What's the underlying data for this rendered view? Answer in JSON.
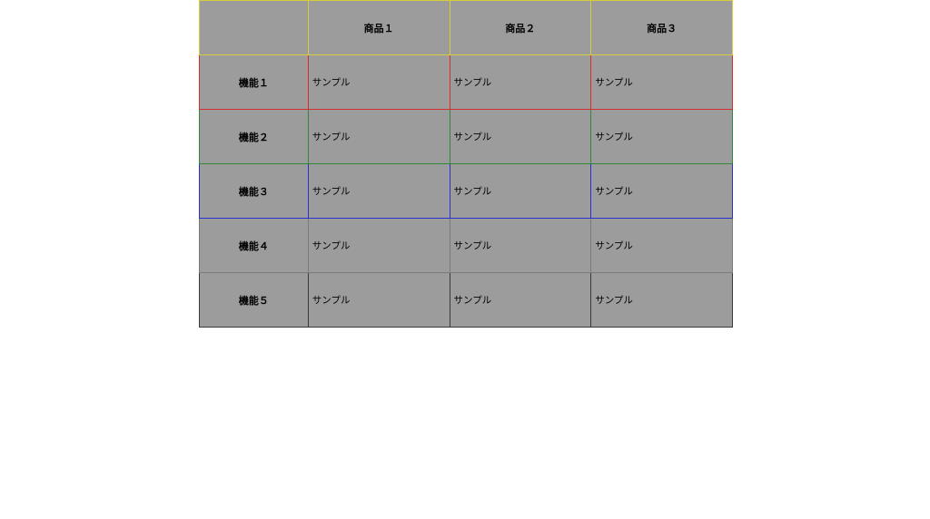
{
  "table": {
    "columns": [
      "商品１",
      "商品２",
      "商品３"
    ],
    "rows": [
      {
        "label": "機能１",
        "cells": [
          "サンプル",
          "サンプル",
          "サンプル"
        ],
        "color": "red"
      },
      {
        "label": "機能２",
        "cells": [
          "サンプル",
          "サンプル",
          "サンプル"
        ],
        "color": "green"
      },
      {
        "label": "機能３",
        "cells": [
          "サンプル",
          "サンプル",
          "サンプル"
        ],
        "color": "blue"
      },
      {
        "label": "機能４",
        "cells": [
          "サンプル",
          "サンプル",
          "サンプル"
        ],
        "color": "gray"
      },
      {
        "label": "機能５",
        "cells": [
          "サンプル",
          "サンプル",
          "サンプル"
        ],
        "color": "dark"
      }
    ],
    "header_color": "yellow"
  },
  "colors": {
    "yellow": "#d6cd3a",
    "red": "#d62e2e",
    "green": "#2e8a3a",
    "blue": "#2a2fd0",
    "gray": "#7a7a7a",
    "dark": "#3a3a3a",
    "cell_bg": "#9c9c9c"
  }
}
